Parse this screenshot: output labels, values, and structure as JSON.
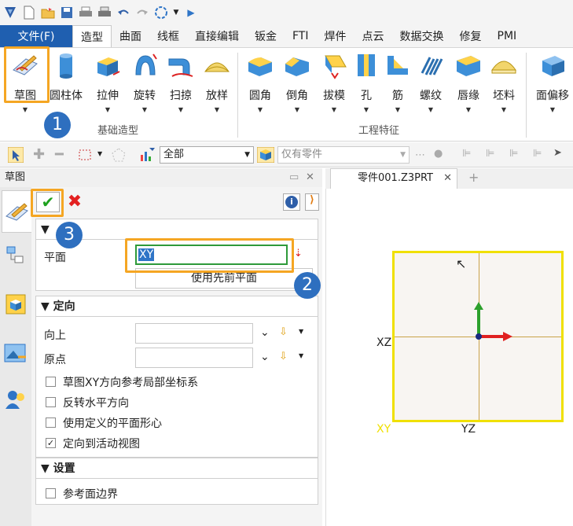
{
  "menu_tabs": [
    "文件(F)",
    "造型",
    "曲面",
    "线框",
    "直接编辑",
    "钣金",
    "FTI",
    "焊件",
    "点云",
    "数据交换",
    "修复",
    "PMI"
  ],
  "ribbon": {
    "basic_group": [
      "草图",
      "圆柱体",
      "拉伸",
      "旋转",
      "扫掠",
      "放样"
    ],
    "basic_group_label": "基础造型",
    "feature_group": [
      "圆角",
      "倒角",
      "拔模",
      "孔",
      "筋",
      "螺纹",
      "唇缘",
      "坯料"
    ],
    "feature_group_label": "工程特征",
    "extra": [
      "面偏移"
    ]
  },
  "filterbar": {
    "filter_value": "全部",
    "part_filter_placeholder": "仅有零件"
  },
  "panel": {
    "title": "草图",
    "section1": {
      "title": "",
      "plane_label": "平面",
      "plane_value": "XY",
      "use_previous_button": "使用先前平面"
    },
    "orientation": {
      "title": "定向",
      "up_label": "向上",
      "origin_label": "原点",
      "options": [
        {
          "label": "草图XY方向参考局部坐标系",
          "checked": false
        },
        {
          "label": "反转水平方向",
          "checked": false
        },
        {
          "label": "使用定义的平面形心",
          "checked": false
        },
        {
          "label": "定向到活动视图",
          "checked": true
        }
      ]
    },
    "settings": {
      "title": "设置",
      "options": [
        {
          "label": "参考面边界",
          "checked": false
        }
      ]
    }
  },
  "viewport": {
    "doc_tab": "零件001.Z3PRT",
    "plane_labels": {
      "xz": "XZ",
      "xy": "XY",
      "yz": "YZ"
    }
  },
  "callouts": [
    "1",
    "2",
    "3"
  ],
  "colors": {
    "accent": "#1f5fb0",
    "highlight": "#f5a623",
    "plane_border": "#f0e000",
    "badge": "#2e6fbf"
  }
}
